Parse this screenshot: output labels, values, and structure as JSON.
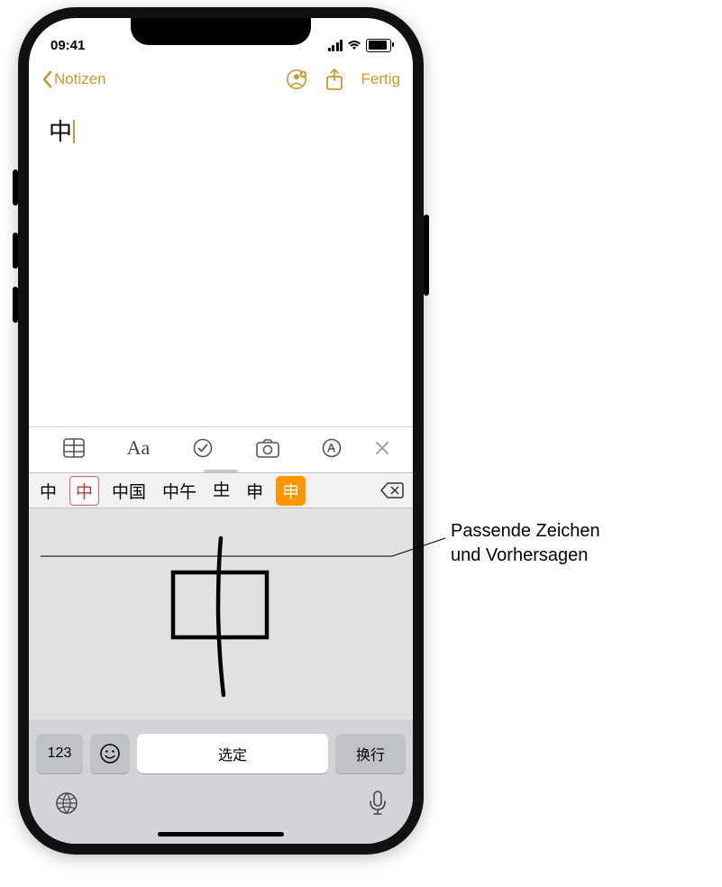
{
  "statusbar": {
    "time": "09:41"
  },
  "nav": {
    "back_label": "Notizen",
    "done_label": "Fertig"
  },
  "note": {
    "content": "中"
  },
  "candidates": {
    "items": [
      "中",
      "中",
      "中国",
      "中午",
      "𠀐",
      "申",
      "申"
    ],
    "selected_index": 1,
    "highlight_index": 6
  },
  "keyboard": {
    "numeric_label": "123",
    "space_label": "选定",
    "enter_label": "换行"
  },
  "callout": {
    "line1": "Passende Zeichen",
    "line2": "und Vorhersagen"
  }
}
